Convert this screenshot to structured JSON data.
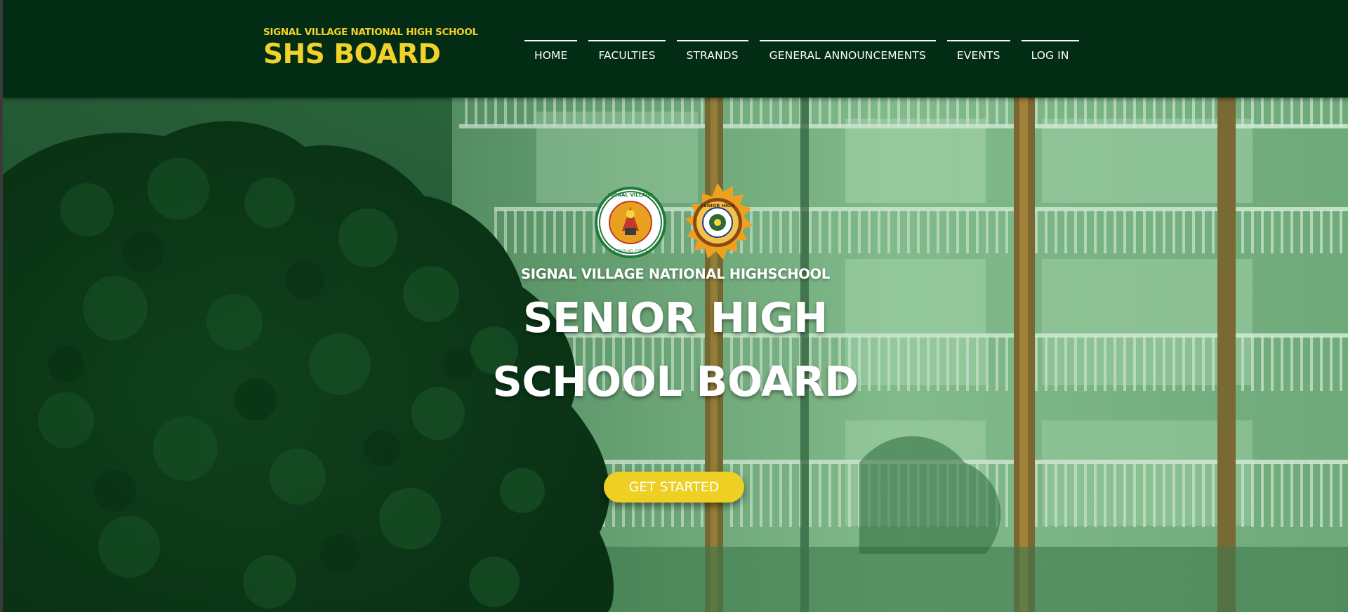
{
  "header": {
    "brand_subtitle": "SIGNAL VILLAGE NATIONAL HIGH SCHOOL",
    "brand_title": "SHS BOARD"
  },
  "nav": {
    "items": [
      "HOME",
      "FACULTIES",
      "STRANDS",
      "GENERAL ANNOUNCEMENTS",
      "EVENTS",
      "LOG IN"
    ]
  },
  "hero": {
    "school_name": "SIGNAL VILLAGE NATIONAL HIGHSCHOOL",
    "title_line1": "SENIOR HIGH",
    "title_line2": "SCHOOL BOARD",
    "cta_label": "GET STARTED",
    "logo_left_text": "SIGNAL VILLAGE NATIONAL HIGH SCHOOL",
    "logo_left_city": "TAGUIG CITY",
    "logo_right_text": "SENIOR HIGH SCHOOL",
    "background_description_icon": "building-and-trees-photo"
  },
  "colors": {
    "header_bg": "#022c14",
    "accent_yellow": "#f0d22a",
    "cta_bg": "#eed024",
    "text_white": "#ffffff"
  }
}
